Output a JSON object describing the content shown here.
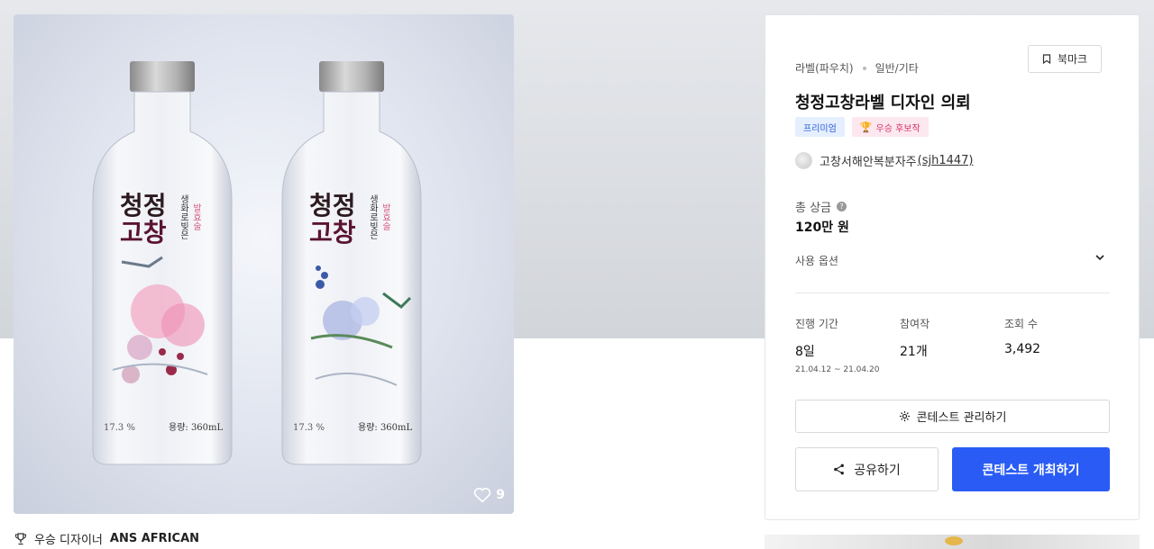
{
  "hero": {
    "likes_count": "9",
    "bottle_left": {
      "brand_line1": "청정",
      "brand_line2": "고창",
      "side_text": "생화로빚은",
      "side_accent": "발효술",
      "abv": "17.3 %",
      "volume": "용량: 360mL"
    },
    "bottle_right": {
      "brand_line1": "청정",
      "brand_line2": "고창",
      "side_text": "생화로빚은",
      "side_accent": "발효술",
      "abv": "17.3 %",
      "volume": "용량: 360mL"
    }
  },
  "award_line": {
    "prefix": "우승 디자이너",
    "designer": "ANS AFRICAN"
  },
  "card": {
    "category": "라벨(파우치)",
    "subcategory": "일반/기타",
    "bookmark_label": "북마크",
    "title": "청정고창라벨 디자인 의뢰",
    "badge_premium": "프리미엄",
    "badge_award": "우승 후보작",
    "host_name": "고창서해안복분자주",
    "host_id": "(sjh1447)",
    "prize_label": "총 상금",
    "prize_value": "120만 원",
    "usage_label": "사용 옵션",
    "stats": {
      "period_label": "진행 기간",
      "period_value": "8일",
      "period_range": "21.04.12 ~ 21.04.20",
      "participants_label": "참여작",
      "participants_value": "21개",
      "views_label": "조회 수",
      "views_value": "3,492"
    },
    "manage_label": "콘테스트 관리하기",
    "share_label": "공유하기",
    "host_contest_label": "콘테스트 개최하기"
  },
  "colors": {
    "primary": "#2a5cf5",
    "premium_bg": "#e5efff",
    "award_bg": "#fde8f0"
  }
}
